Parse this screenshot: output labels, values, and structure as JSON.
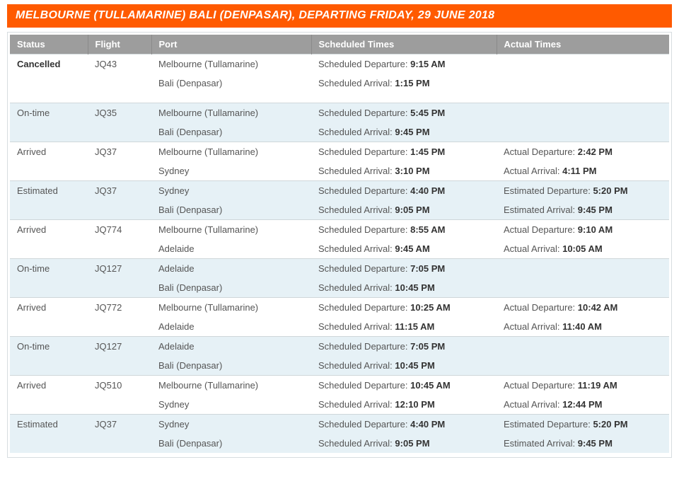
{
  "title": "MELBOURNE (TULLAMARINE) BALI (DENPASAR), DEPARTING FRIDAY, 29 JUNE 2018",
  "columns": {
    "status": "Status",
    "flight": "Flight",
    "port": "Port",
    "scheduled": "Scheduled Times",
    "actual": "Actual Times"
  },
  "scheduled_dep_label": "Scheduled Departure: ",
  "scheduled_arr_label": "Scheduled Arrival: ",
  "actual_dep_label": "Actual Departure: ",
  "actual_arr_label": "Actual Arrival: ",
  "estimated_dep_label": "Estimated Departure: ",
  "estimated_arr_label": "Estimated Arrival: ",
  "flights": [
    {
      "status": "Cancelled",
      "status_bold": true,
      "flight_no": "JQ43",
      "dep_port": "Melbourne (Tullamarine)",
      "arr_port": "Bali (Denpasar)",
      "sched_dep": "9:15 AM",
      "sched_arr": "1:15 PM",
      "actual_type": "none",
      "actual_dep": "",
      "actual_arr": "",
      "gap_after": true
    },
    {
      "status": "On-time",
      "flight_no": "JQ35",
      "dep_port": "Melbourne (Tullamarine)",
      "arr_port": "Bali (Denpasar)",
      "sched_dep": "5:45 PM",
      "sched_arr": "9:45 PM",
      "actual_type": "none",
      "actual_dep": "",
      "actual_arr": ""
    },
    {
      "status": "Arrived",
      "flight_no": "JQ37",
      "dep_port": "Melbourne (Tullamarine)",
      "arr_port": "Sydney",
      "sched_dep": "1:45 PM",
      "sched_arr": "3:10 PM",
      "actual_type": "actual",
      "actual_dep": "2:42 PM",
      "actual_arr": "4:11 PM"
    },
    {
      "status": "Estimated",
      "flight_no": "JQ37",
      "dep_port": "Sydney",
      "arr_port": "Bali (Denpasar)",
      "sched_dep": "4:40 PM",
      "sched_arr": "9:05 PM",
      "actual_type": "estimated",
      "actual_dep": "5:20 PM",
      "actual_arr": "9:45 PM"
    },
    {
      "status": "Arrived",
      "flight_no": "JQ774",
      "dep_port": "Melbourne (Tullamarine)",
      "arr_port": "Adelaide",
      "sched_dep": "8:55 AM",
      "sched_arr": "9:45 AM",
      "actual_type": "actual",
      "actual_dep": "9:10 AM",
      "actual_arr": "10:05 AM"
    },
    {
      "status": "On-time",
      "flight_no": "JQ127",
      "dep_port": "Adelaide",
      "arr_port": "Bali (Denpasar)",
      "sched_dep": "7:05 PM",
      "sched_arr": "10:45 PM",
      "actual_type": "none",
      "actual_dep": "",
      "actual_arr": ""
    },
    {
      "status": "Arrived",
      "flight_no": "JQ772",
      "dep_port": "Melbourne (Tullamarine)",
      "arr_port": "Adelaide",
      "sched_dep": "10:25 AM",
      "sched_arr": "11:15 AM",
      "actual_type": "actual",
      "actual_dep": "10:42 AM",
      "actual_arr": "11:40 AM"
    },
    {
      "status": "On-time",
      "flight_no": "JQ127",
      "dep_port": "Adelaide",
      "arr_port": "Bali (Denpasar)",
      "sched_dep": "7:05 PM",
      "sched_arr": "10:45 PM",
      "actual_type": "none",
      "actual_dep": "",
      "actual_arr": ""
    },
    {
      "status": "Arrived",
      "flight_no": "JQ510",
      "dep_port": "Melbourne (Tullamarine)",
      "arr_port": "Sydney",
      "sched_dep": "10:45 AM",
      "sched_arr": "12:10 PM",
      "actual_type": "actual",
      "actual_dep": "11:19 AM",
      "actual_arr": "12:44 PM"
    },
    {
      "status": "Estimated",
      "flight_no": "JQ37",
      "dep_port": "Sydney",
      "arr_port": "Bali (Denpasar)",
      "sched_dep": "4:40 PM",
      "sched_arr": "9:05 PM",
      "actual_type": "estimated",
      "actual_dep": "5:20 PM",
      "actual_arr": "9:45 PM"
    }
  ]
}
